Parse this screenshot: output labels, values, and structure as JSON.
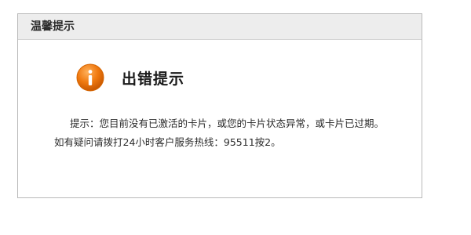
{
  "dialog": {
    "header_title": "温馨提示",
    "icon": "info-icon",
    "error_title": "出错提示",
    "message_line1": "提示：您目前没有已激活的卡片，或您的卡片状态异常，或卡片已过期。",
    "message_line2": "如有疑问请拨打24小时客户服务热线：95511按2。"
  },
  "colors": {
    "header_bg": "#ededed",
    "border": "#b9b9b9",
    "icon_orange": "#f07a10"
  }
}
